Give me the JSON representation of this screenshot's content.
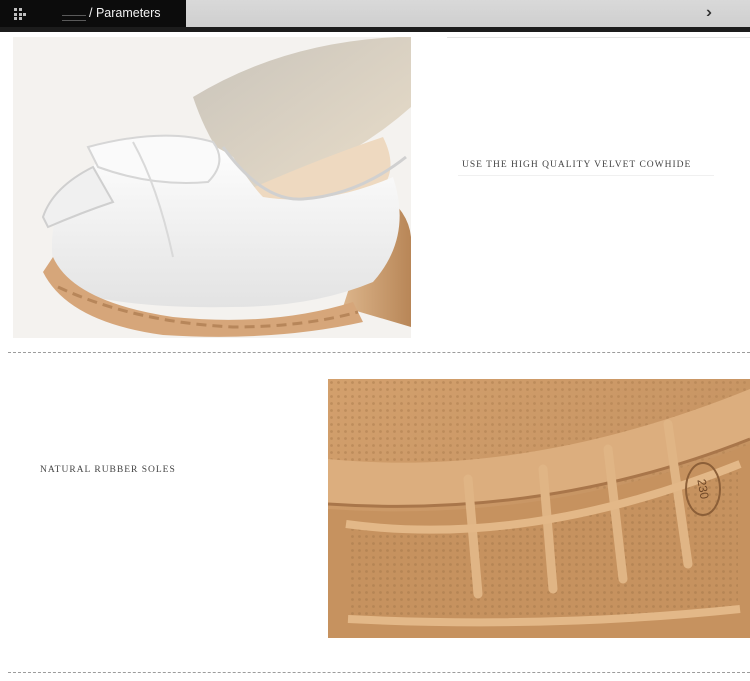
{
  "header": {
    "title": "/ Parameters",
    "icons": [
      "grid-icon",
      "bar-icon",
      "chevron-right-triple-icon"
    ]
  },
  "features": [
    {
      "caption": "USE THE HIGH QUALITY VELVET COWHIDE"
    },
    {
      "caption": "NATURAL RUBBER SOLES"
    }
  ],
  "sole_mark": "230",
  "colors": {
    "header_bg": "#d4d4d4",
    "header_tab": "#0c0c0c",
    "rule": "#1c1c1c",
    "leather": "#f4f4f4",
    "rubber": "#c89664"
  }
}
